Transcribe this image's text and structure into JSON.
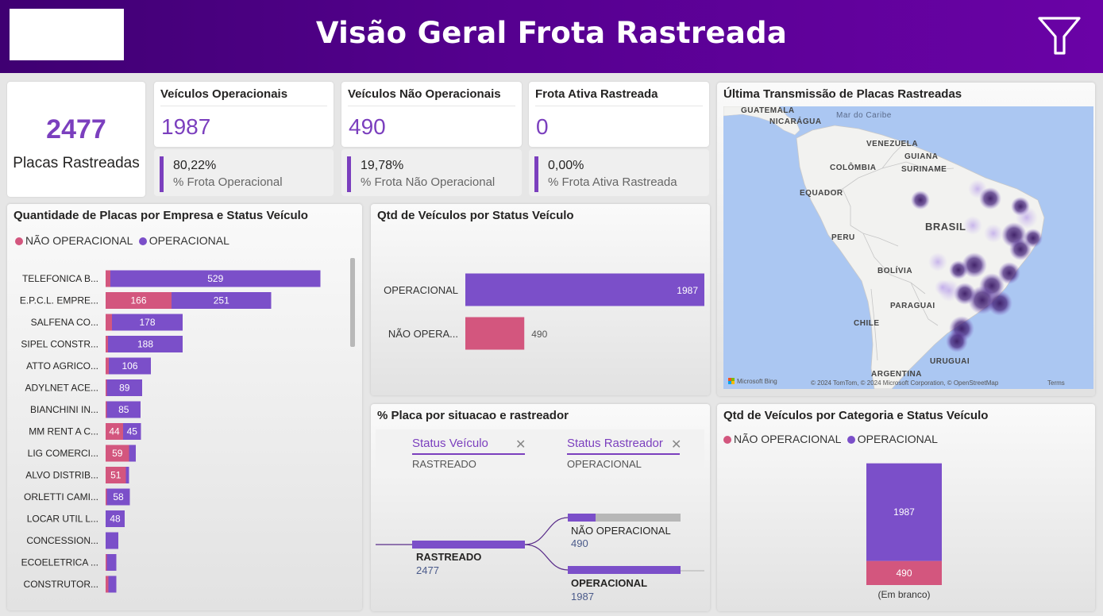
{
  "header": {
    "title": "Visão Geral Frota Rastreada"
  },
  "total_card": {
    "value": "2477",
    "label": "Placas Rastreadas"
  },
  "kpis": [
    {
      "title": "Veículos Operacionais",
      "value": "1987",
      "pct": "80,22%",
      "sub": "% Frota Operacional"
    },
    {
      "title": "Veículos Não Operacionais",
      "value": "490",
      "pct": "19,78%",
      "sub": "% Frota Não Operacional"
    },
    {
      "title": "Frota Ativa Rastreada",
      "value": "0",
      "pct": "0,00%",
      "sub": "% Frota Ativa Rastreada"
    }
  ],
  "colors": {
    "operacional": "#7b4fc9",
    "nao_operacional": "#d3567e",
    "header": "#55008f"
  },
  "company_chart": {
    "title": "Quantidade de Placas por Empresa e Status Veículo",
    "legend": [
      "NÃO OPERACIONAL",
      "OPERACIONAL"
    ]
  },
  "status_chart": {
    "title": "Qtd de Veículos por Status Veículo"
  },
  "map": {
    "title": "Última Transmissão de Placas Rastreadas",
    "labels": [
      "GUATEMALA",
      "NICARÁGUA",
      "Mar do Caribe",
      "VENEZUELA",
      "GUIANA",
      "COLÔMBIA",
      "SURINAME",
      "EQUADOR",
      "BRASIL",
      "PERU",
      "BOLÍVIA",
      "PARAGUAI",
      "CHILE",
      "URUGUAI",
      "ARGENTINA"
    ],
    "bing": "Microsoft Bing",
    "copyright": "© 2024 TomTom, © 2024 Microsoft Corporation, © OpenStreetMap",
    "terms": "Terms"
  },
  "decomp": {
    "title": "% Placa por situacao e rastreador",
    "levels": [
      {
        "name": "Status Veículo",
        "value": "RASTREADO"
      },
      {
        "name": "Status Rastreador",
        "value": "OPERACIONAL"
      }
    ],
    "root": {
      "label": "RASTREADO",
      "value": "2477"
    },
    "nodes": [
      {
        "label": "NÃO OPERACIONAL",
        "value": "490"
      },
      {
        "label": "OPERACIONAL",
        "value": "1987"
      }
    ]
  },
  "category_chart": {
    "title": "Qtd de Veículos por Categoria e Status Veículo",
    "legend": [
      "NÃO OPERACIONAL",
      "OPERACIONAL"
    ]
  },
  "chart_data": [
    {
      "type": "bar",
      "orientation": "horizontal",
      "stacked": true,
      "title": "Quantidade de Placas por Empresa e Status Veículo",
      "categories": [
        "TELEFONICA B...",
        "E.P.C.L. EMPRE...",
        "SALFENA CO...",
        "SIPEL CONSTR...",
        "ATTO AGRICO...",
        "ADYLNET ACE...",
        "BIANCHINI IN...",
        "MM RENT A C...",
        "LIG COMERCI...",
        "ALVO DISTRIB...",
        "ORLETTI CAMI...",
        "LOCAR UTIL L...",
        "CONCESSION...",
        "ECOELETRICA ...",
        "CONSTRUTOR..."
      ],
      "series": [
        {
          "name": "NÃO OPERACIONAL",
          "values": [
            12,
            166,
            16,
            6,
            8,
            3,
            3,
            44,
            59,
            51,
            3,
            0,
            0,
            3,
            7
          ],
          "labels": [
            "",
            "166",
            "",
            "",
            "",
            "",
            "",
            "44",
            "59",
            "51",
            "",
            "",
            "",
            "",
            ""
          ]
        },
        {
          "name": "OPERACIONAL",
          "values": [
            529,
            251,
            178,
            188,
            106,
            89,
            85,
            45,
            17,
            8,
            58,
            48,
            32,
            24,
            20
          ],
          "labels": [
            "529",
            "251",
            "178",
            "188",
            "106",
            "89",
            "85",
            "45",
            "",
            "",
            "58",
            "48",
            "",
            "",
            ""
          ]
        }
      ]
    },
    {
      "type": "bar",
      "orientation": "horizontal",
      "title": "Qtd de Veículos por Status Veículo",
      "categories": [
        "OPERACIONAL",
        "NÃO OPERA..."
      ],
      "values": [
        1987,
        490
      ],
      "xlim": [
        0,
        1987
      ]
    },
    {
      "type": "bar",
      "stacked": true,
      "title": "Qtd de Veículos por Categoria e Status Veículo",
      "categories": [
        "(Em branco)"
      ],
      "series": [
        {
          "name": "NÃO OPERACIONAL",
          "values": [
            490
          ]
        },
        {
          "name": "OPERACIONAL",
          "values": [
            1987
          ]
        }
      ]
    }
  ]
}
